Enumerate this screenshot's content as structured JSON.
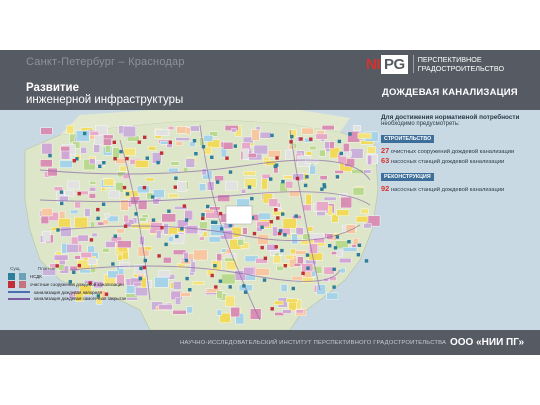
{
  "header": {
    "route": "Санкт-Петербург – Краснодар",
    "title_bold": "Развитие",
    "title_regular": "инженерной инфраструктуры",
    "section_title": "ДОЖДЕВАЯ КАНАЛИЗАЦИЯ"
  },
  "logo": {
    "mark_prefix": "NI",
    "mark_box": "PG",
    "line1": "ПЕРСПЕКТИВНОЕ",
    "line2": "ГРАДОСТРОИТЕЛЬСТВО"
  },
  "info": {
    "heading": "Для достижения нормативной потребности",
    "subheading": "необходимо предусмотреть:",
    "construction_tag": "СТРОИТЕЛЬСТВО",
    "construction": [
      {
        "num": "27",
        "text": "очистных сооружений дождевой канализации"
      },
      {
        "num": "63",
        "text": "насосных станций дождевой канализации"
      }
    ],
    "reconstruction_tag": "РЕКОНСТРУКЦИЯ",
    "reconstruction": [
      {
        "num": "92",
        "text": "насосных станций дождевой канализации"
      }
    ]
  },
  "legend": {
    "col_a": "Сущ.",
    "col_b": "План-ие",
    "items": [
      {
        "label": "НСДК",
        "color": "#2e7d9b"
      },
      {
        "label": "очистные сооружения дождевой канализации",
        "color": "#c0303a"
      },
      {
        "label": "канализация дождевая напорная",
        "color": "#4a6fb0"
      },
      {
        "label": "канализация дождевая самотечная закрытая",
        "color": "#7a5aa0"
      }
    ]
  },
  "footer": {
    "institute": "НАУЧНО-ИССЛЕДОВАТЕЛЬСКИЙ ИНСТИТУТ ПЕРСПЕКТИВНОГО ГРАДОСТРОИТЕЛЬСТВА",
    "company": "ООО «НИИ ПГ»"
  },
  "colors": {
    "band": "#565a63",
    "accent_red": "#d8322b",
    "tag_blue": "#3d6f9a",
    "water": "#c9d9e3"
  }
}
